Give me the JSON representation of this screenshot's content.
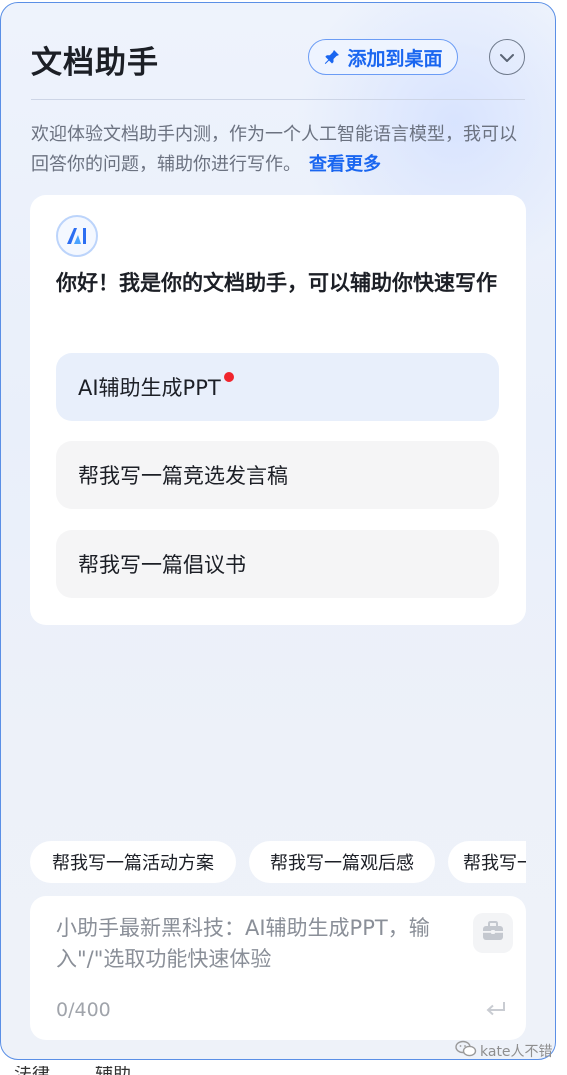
{
  "header": {
    "title": "文档助手",
    "pin_label": "添加到桌面",
    "pin_icon": "pin-icon",
    "collapse_icon": "chevron-down-icon"
  },
  "intro": {
    "text": "欢迎体验文档助手内测，作为一个人工智能语言模型，我可以回答你的问题，辅助你进行写作。",
    "more_link": "查看更多"
  },
  "welcome_card": {
    "logo_icon": "ai-logo-icon",
    "greeting": "你好！我是你的文档助手，可以辅助你快速写作",
    "suggestions": [
      {
        "label": "AI辅助生成PPT",
        "has_new_dot": true
      },
      {
        "label": "帮我写一篇竞选发言稿",
        "has_new_dot": false
      },
      {
        "label": "帮我写一篇倡议书",
        "has_new_dot": false
      }
    ]
  },
  "quick_chips": [
    "帮我写一篇活动方案",
    "帮我写一篇观后感",
    "帮我写一"
  ],
  "composer": {
    "placeholder": "小助手最新黑科技：AI辅助生成PPT，输入\"/\"选取功能快速体验",
    "counter": "0/400",
    "toolbox_icon": "toolbox-icon",
    "send_icon": "send-enter-icon"
  },
  "watermark": {
    "text": "kate人不错",
    "icon": "wechat-icon"
  },
  "below_panel": [
    "法律",
    "辅助"
  ],
  "colors": {
    "accent": "#1a66f0",
    "panel_border": "#5a8fe6",
    "new_dot": "#f0252d"
  }
}
